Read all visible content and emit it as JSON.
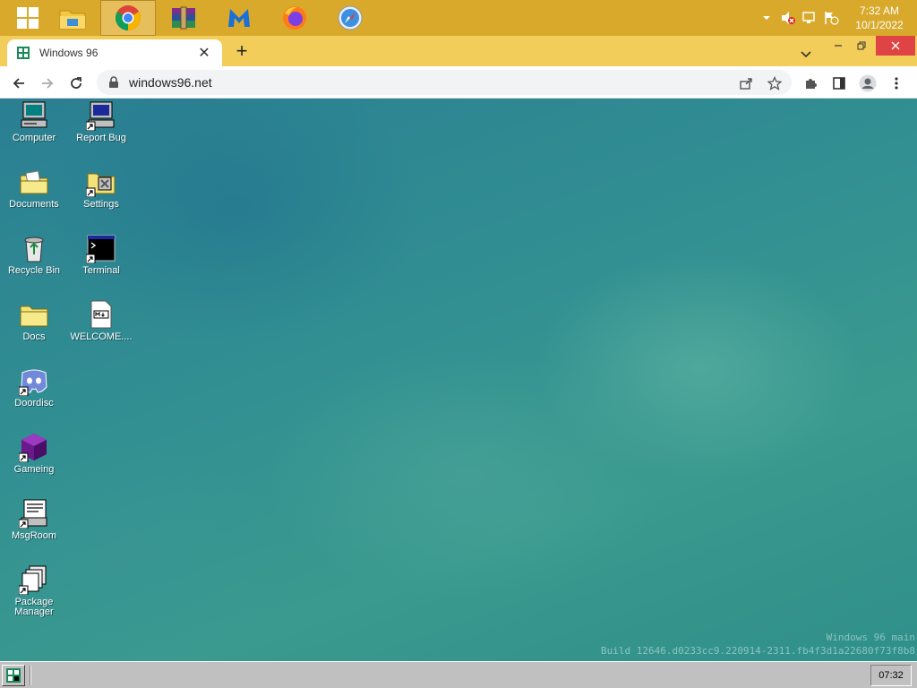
{
  "host_taskbar": {
    "apps": [
      {
        "name": "windows-start-icon"
      },
      {
        "name": "file-explorer-icon"
      },
      {
        "name": "chrome-icon",
        "active": true
      },
      {
        "name": "winrar-icon"
      },
      {
        "name": "malwarebytes-icon"
      },
      {
        "name": "firefox-icon"
      },
      {
        "name": "safari-icon"
      }
    ],
    "clock": {
      "time": "7:32 AM",
      "date": "10/1/2022"
    }
  },
  "browser": {
    "tab": {
      "title": "Windows 96"
    },
    "new_tab_symbol": "+",
    "url": "windows96.net"
  },
  "desktop": {
    "icons": [
      {
        "label": "Computer",
        "icon": "computer-icon"
      },
      {
        "label": "Report Bug",
        "icon": "report-bug-icon"
      },
      {
        "label": "Documents",
        "icon": "documents-folder-icon"
      },
      {
        "label": "Settings",
        "icon": "settings-icon"
      },
      {
        "label": "Recycle Bin",
        "icon": "recycle-bin-icon"
      },
      {
        "label": "Terminal",
        "icon": "terminal-icon"
      },
      {
        "label": "Docs",
        "icon": "folder-icon"
      },
      {
        "label": "WELCOME....",
        "icon": "markdown-file-icon"
      },
      {
        "label": "Doordisc",
        "icon": "discord-icon"
      },
      {
        "label": "Gameing",
        "icon": "game-cube-icon"
      },
      {
        "label": "MsgRoom",
        "icon": "msgroom-icon"
      },
      {
        "label": "Package Manager",
        "icon": "package-manager-icon"
      }
    ],
    "build_info": {
      "line1": "Windows 96 main",
      "line2": "Build 12646.d0233cc9.220914-2311.fb4f3d1a22680f73f8b8"
    }
  },
  "w96_taskbar": {
    "clock": "07:32"
  },
  "colors": {
    "host_taskbar": "#d8a92b",
    "tabstrip": "#f2cd5a",
    "desktop": "#2f8a8c",
    "w96_taskbar": "#c0c0c0"
  }
}
